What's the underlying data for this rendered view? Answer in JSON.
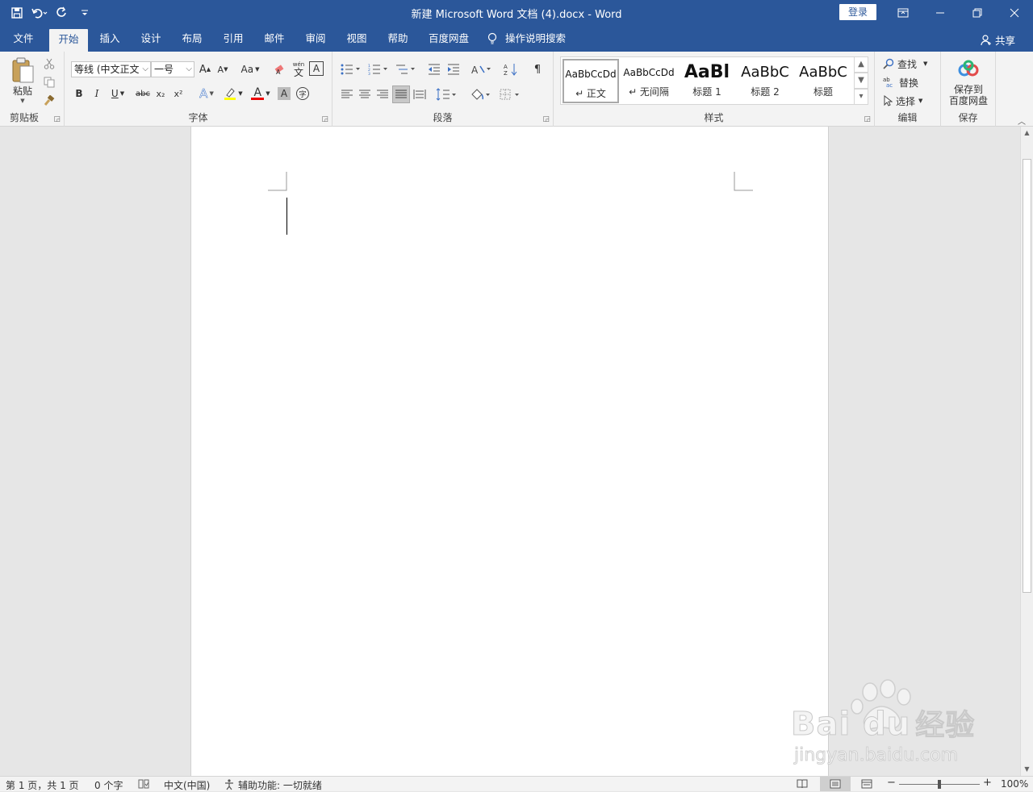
{
  "titlebar": {
    "document_title": "新建 Microsoft Word 文档 (4).docx  -  Word",
    "login_label": "登录",
    "qat": {
      "save_icon": "save-icon",
      "undo_icon": "undo-icon",
      "redo_icon": "redo-icon",
      "customize_icon": "customize-qat-icon"
    }
  },
  "tabs": [
    {
      "label": "文件"
    },
    {
      "label": "开始"
    },
    {
      "label": "插入"
    },
    {
      "label": "设计"
    },
    {
      "label": "布局"
    },
    {
      "label": "引用"
    },
    {
      "label": "邮件"
    },
    {
      "label": "审阅"
    },
    {
      "label": "视图"
    },
    {
      "label": "帮助"
    },
    {
      "label": "百度网盘"
    }
  ],
  "tell_me": "操作说明搜索",
  "share_label": "共享",
  "ribbon": {
    "clipboard": {
      "label": "剪贴板",
      "paste_label": "粘贴"
    },
    "font": {
      "label": "字体",
      "font_name": "等线 (中文正文",
      "font_size": "一号",
      "case_label": "Aa",
      "phonetic": "wén",
      "bold": "B",
      "italic": "I",
      "underline": "U",
      "strike": "abc",
      "sub": "x₂",
      "sup": "x²",
      "text_effect": "A",
      "font_color": "A",
      "char_shading": "A",
      "enclose": "字"
    },
    "paragraph": {
      "label": "段落"
    },
    "styles": {
      "label": "样式",
      "items": [
        {
          "preview": "AaBbCcDd",
          "name": "↵ 正文"
        },
        {
          "preview": "AaBbCcDd",
          "name": "↵ 无间隔"
        },
        {
          "preview": "AaBl",
          "name": "标题 1"
        },
        {
          "preview": "AaBbC",
          "name": "标题 2"
        },
        {
          "preview": "AaBbC",
          "name": "标题"
        }
      ]
    },
    "editing": {
      "label": "编辑",
      "find": "查找",
      "replace": "替换",
      "select": "选择"
    },
    "save": {
      "label": "保存",
      "button_label_1": "保存到",
      "button_label_2": "百度网盘"
    }
  },
  "status": {
    "page": "第 1 页，共 1 页",
    "words": "0 个字",
    "language": "中文(中国)",
    "accessibility": "辅助功能: 一切就绪",
    "zoom": "100%",
    "zoom_minus": "−",
    "zoom_plus": "+"
  },
  "watermark": {
    "brand": "Bai  du",
    "brand_cn": "经验",
    "url": "jingyan.baidu.com"
  },
  "colors": {
    "accent": "#2b579a",
    "ribbon_bg": "#f3f3f3",
    "canvas_bg": "#e6e6e6"
  }
}
